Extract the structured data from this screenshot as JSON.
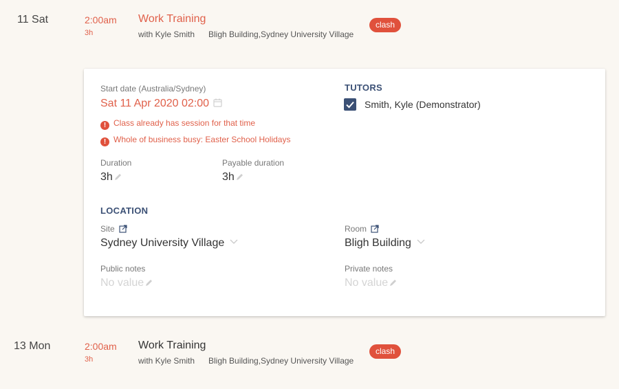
{
  "sessions": [
    {
      "date": "11 Sat",
      "time": "2:00am",
      "duration": "3h",
      "title": "Work Training",
      "with": "with Kyle Smith",
      "location": "Bligh Building,Sydney University Village",
      "badge": "clash"
    },
    {
      "date": "13 Mon",
      "time": "2:00am",
      "duration": "3h",
      "title": "Work Training",
      "with": "with Kyle Smith",
      "location": "Bligh Building,Sydney University Village",
      "badge": "clash"
    }
  ],
  "detail": {
    "start_label": "Start date (Australia/Sydney)",
    "start_value": "Sat 11 Apr 2020 02:00",
    "warnings": [
      "Class already has session for that time",
      "Whole of business busy: Easter School Holidays"
    ],
    "duration_label": "Duration",
    "duration_value": "3h",
    "payable_label": "Payable duration",
    "payable_value": "3h",
    "tutors_heading": "TUTORS",
    "tutor_name": "Smith, Kyle (Demonstrator)",
    "tutor_checked": true,
    "location_heading": "LOCATION",
    "site_label": "Site",
    "site_value": "Sydney University Village",
    "room_label": "Room",
    "room_value": "Bligh Building",
    "public_notes_label": "Public notes",
    "public_notes_value": "No value",
    "private_notes_label": "Private notes",
    "private_notes_value": "No value"
  },
  "colors": {
    "background": "#faf7f2",
    "accent_red": "#e0604a",
    "badge_red": "#e0513c",
    "heading_blue": "#3b5075"
  }
}
